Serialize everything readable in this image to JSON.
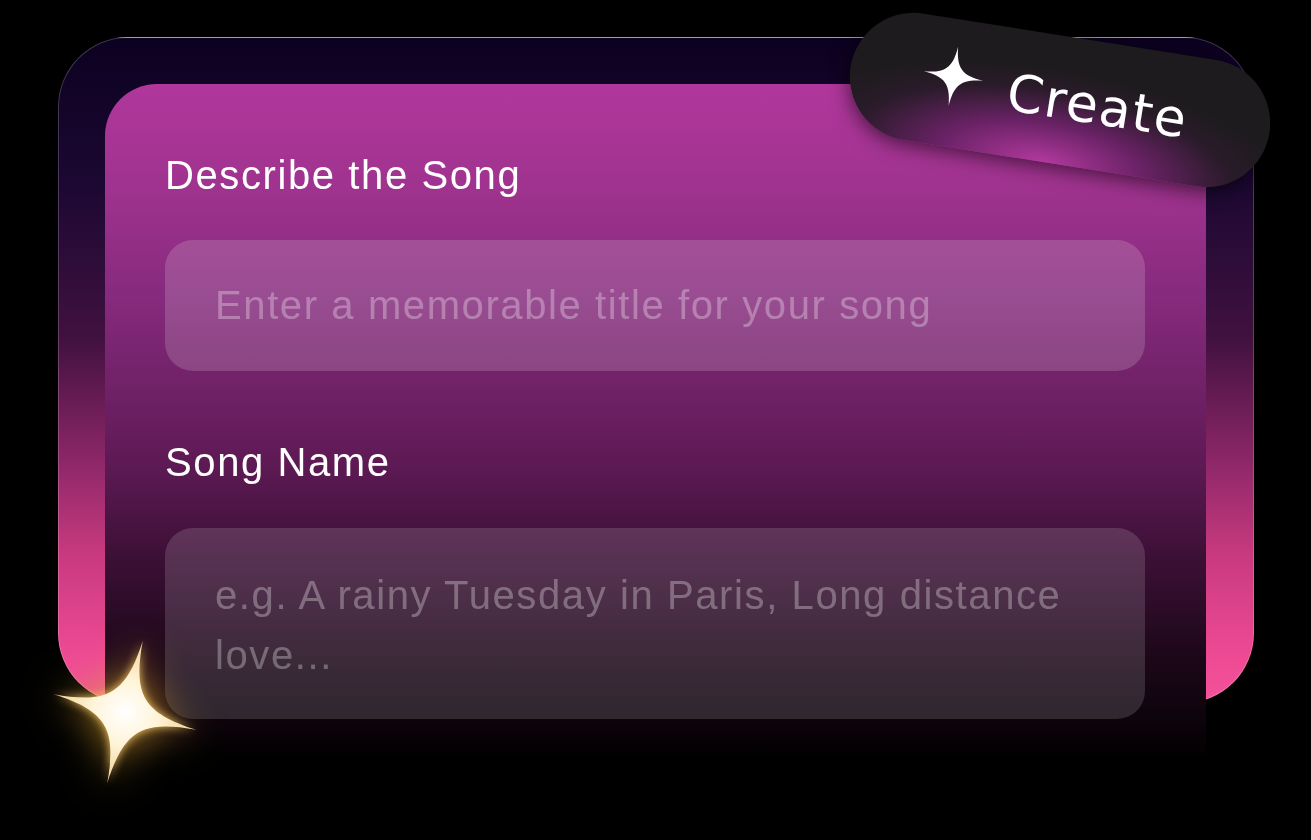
{
  "create_button": {
    "label": "Create"
  },
  "fields": [
    {
      "kind": "input",
      "label": "Describe the Song",
      "placeholder": "Enter a memorable title for your song"
    },
    {
      "kind": "textarea",
      "label": "Song Name",
      "placeholder": "e.g. A rainy Tuesday in Paris, Long distance love..."
    }
  ]
}
